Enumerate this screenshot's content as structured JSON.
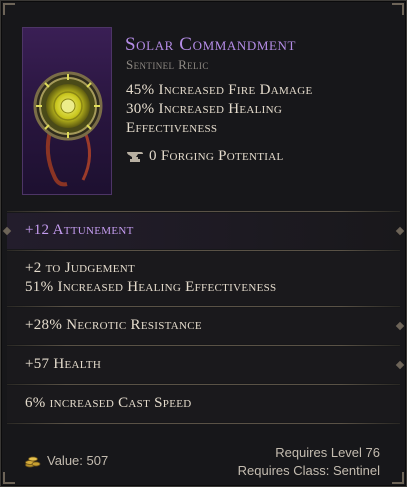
{
  "item": {
    "name": "Solar Commandment",
    "type": "Sentinel Relic",
    "implicits": [
      "45% Increased Fire Damage",
      "30% Increased Healing",
      "Effectiveness"
    ],
    "forging_potential": "0 Forging Potential"
  },
  "affixes": [
    {
      "lines": [
        "+12 Attunement"
      ],
      "color": "#c49cf0"
    },
    {
      "lines": [
        "+2 to Judgement",
        "51% Increased Healing Effectiveness"
      ],
      "color": "#e4dbcc"
    },
    {
      "lines": [
        "+28% Necrotic Resistance"
      ],
      "color": "#e4dbcc"
    },
    {
      "lines": [
        "+57 Health"
      ],
      "color": "#e4dbcc"
    },
    {
      "lines": [
        "6% increased Cast Speed"
      ],
      "color": "#e4dbcc"
    }
  ],
  "footer": {
    "value": "Value: 507",
    "requires_level": "Requires Level 76",
    "requires_class": "Requires Class: Sentinel"
  },
  "icons": {
    "item_art": "sun-relic-icon",
    "forging": "anvil-icon",
    "value": "gold-coins-icon"
  },
  "colors": {
    "unique_name": "#b48ce6",
    "primary_affix": "#c49cf0",
    "stat_text": "#e4dbcc",
    "background": "#17171a"
  }
}
